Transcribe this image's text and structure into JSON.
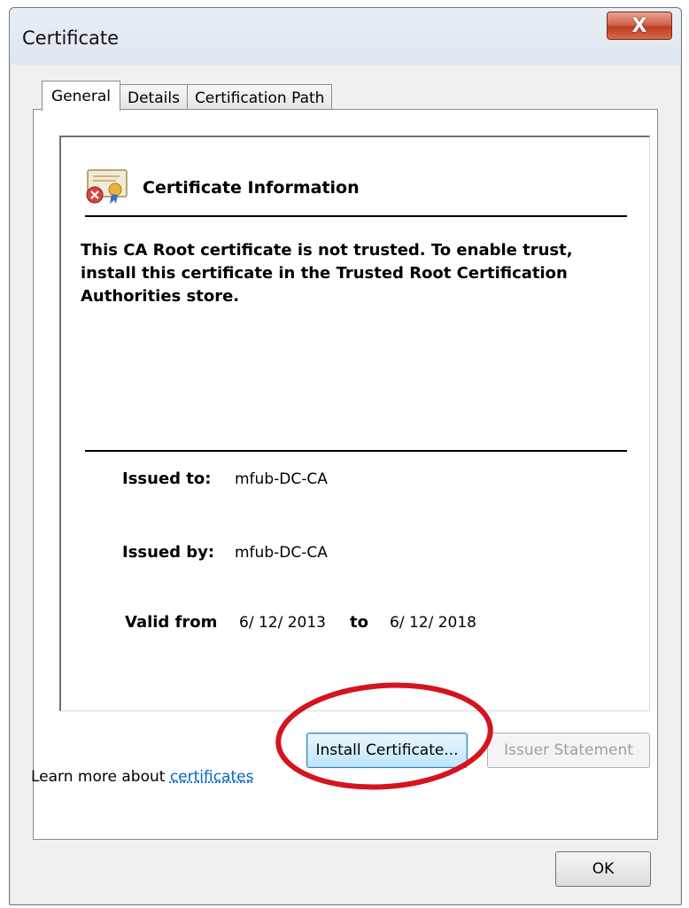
{
  "window": {
    "title": "Certificate",
    "close_glyph": "X"
  },
  "tabs": [
    {
      "label": "General",
      "active": true
    },
    {
      "label": "Details",
      "active": false
    },
    {
      "label": "Certification Path",
      "active": false
    }
  ],
  "info": {
    "icon": "certificate-error-icon",
    "heading": "Certificate Information",
    "warning": "This CA Root certificate is not trusted. To enable trust, install this certificate in the Trusted Root Certification Authorities store.",
    "issued_to_label": "Issued to:",
    "issued_to_value": "mfub-DC-CA",
    "issued_by_label": "Issued by:",
    "issued_by_value": "mfub-DC-CA",
    "valid_from_label": "Valid from",
    "valid_from_value": "6/ 12/ 2013",
    "valid_to_label": "to",
    "valid_to_value": "6/ 12/ 2018"
  },
  "buttons": {
    "install": "Install Certificate...",
    "issuer_statement": "Issuer Statement",
    "ok": "OK"
  },
  "learn_more": {
    "prefix": "Learn more about ",
    "link": "certificates"
  },
  "colors": {
    "highlight_ellipse": "#d4141e",
    "link": "#0066cc",
    "close_button": "#c23d22"
  }
}
